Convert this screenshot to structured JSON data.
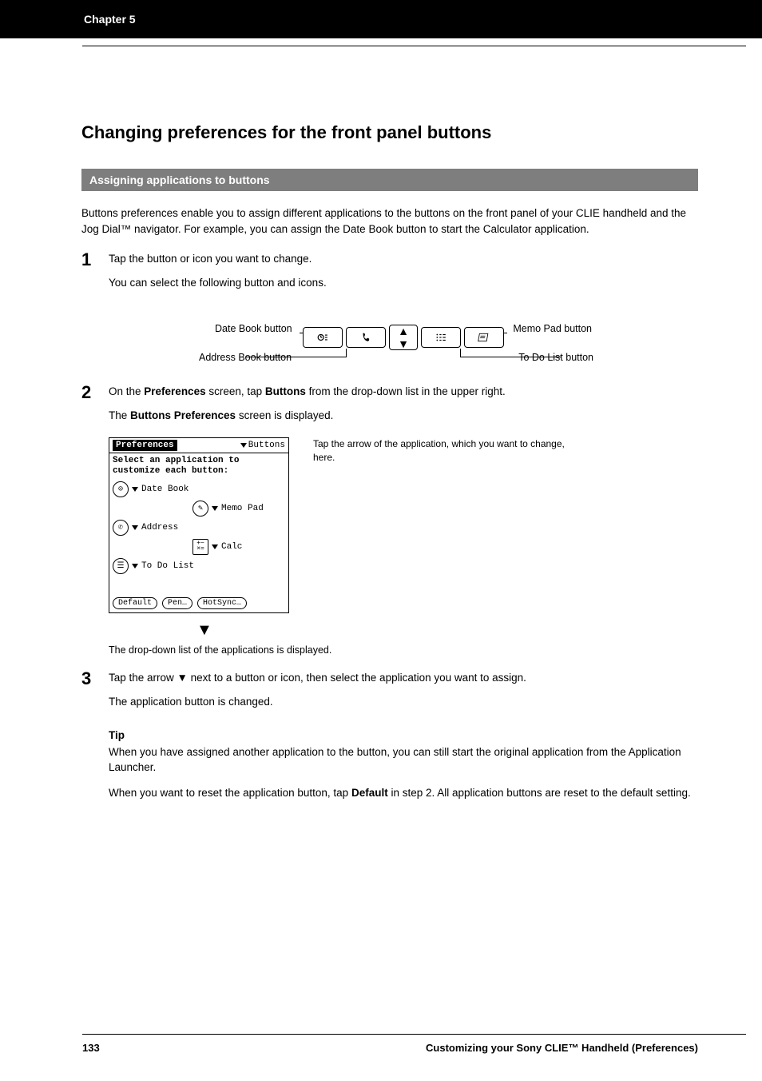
{
  "header": {
    "chapter": "Chapter 5"
  },
  "section": {
    "title": "Changing preferences for the front panel buttons",
    "subtitle": "Assigning applications to buttons",
    "intro": "Buttons preferences enable you to assign different applications to the buttons on the front panel of your CLIE handheld and the Jog Dial™ navigator. For example, you can assign the Date Book button to start the Calculator application."
  },
  "steps": {
    "s1": {
      "num": "1",
      "text": "Tap the button or icon you want to change.",
      "after": "You can select the following button and icons."
    },
    "s2": {
      "num": "2",
      "text": "On the <b>Preferences</b> screen, tap <b>Buttons</b> from the drop-down list in the upper right.",
      "after": "The <b>Buttons Preferences</b> screen is displayed."
    },
    "s3": {
      "num": "3",
      "text": "Tap the arrow ▼ next to a button or icon, then select the application you want to assign.",
      "after": "The application button is changed."
    }
  },
  "hw": {
    "date_label": "Date Book button",
    "address_label": "Address Book button",
    "todo_label": "To Do List button",
    "memo_label": "Memo Pad button"
  },
  "screen": {
    "title": "Preferences",
    "top_right": "Buttons",
    "body1": "Select an application to",
    "body2": "customize each button:",
    "opt_datebook": "Date Book",
    "opt_memopad": "Memo Pad",
    "opt_address": "Address",
    "opt_calc": "Calc",
    "opt_todo": "To Do List",
    "btn_default": "Default",
    "btn_pen": "Pen…",
    "btn_hotsync": "HotSync…"
  },
  "caption_right": "Tap the arrow of the application, which you want to change, here.",
  "caption_below": "The drop-down list of the applications is displayed.",
  "tip": {
    "label": "Tip",
    "p1": "When you have assigned another application to the button, you can still start the original application from the Application Launcher.",
    "p2": "When you want to reset the application button, tap <b>Default</b> in step 2. All application buttons are reset to the default setting."
  },
  "footer": {
    "left": "133",
    "right": "Customizing your Sony CLIE™ Handheld (Preferences)"
  }
}
